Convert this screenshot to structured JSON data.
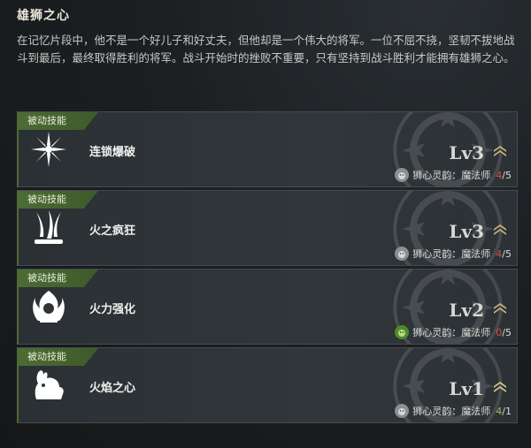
{
  "header": {
    "title": "雄狮之心",
    "description": "在记忆片段中，他不是一个好儿子和好丈夫，但他却是一个伟大的将军。一位不屈不挠，坚韧不拔地战斗到最后，最终取得胜利的将军。战斗开始时的挫败不重要，只有坚持到战斗胜利才能拥有雄狮之心。"
  },
  "skills": [
    {
      "tag": "被动技能",
      "name": "连锁爆破",
      "level": "Lv3",
      "footer_label": "狮心灵韵：魔法师",
      "current": "4",
      "sep": "/",
      "max": "5",
      "icon": "burst-icon",
      "complete": false
    },
    {
      "tag": "被动技能",
      "name": "火之疯狂",
      "level": "Lv3",
      "footer_label": "狮心灵韵：魔法师",
      "current": "4",
      "sep": "/",
      "max": "5",
      "icon": "flame-claw-icon",
      "complete": false
    },
    {
      "tag": "被动技能",
      "name": "火力强化",
      "level": "Lv2",
      "footer_label": "狮心灵韵：魔法师",
      "current": "0",
      "sep": "/",
      "max": "5",
      "icon": "flame-mage-icon",
      "complete": false
    },
    {
      "tag": "被动技能",
      "name": "火焰之心",
      "level": "Lv1",
      "footer_label": "狮心灵韵：魔法师",
      "current": "4",
      "sep": "/",
      "max": "1",
      "icon": "fire-beast-icon",
      "complete": true
    }
  ],
  "colors": {
    "tag_green": "#4d6b35",
    "count_incomplete": "#d7523f",
    "count_complete": "#9fc35b",
    "rank_gold": "#c9b77a"
  }
}
